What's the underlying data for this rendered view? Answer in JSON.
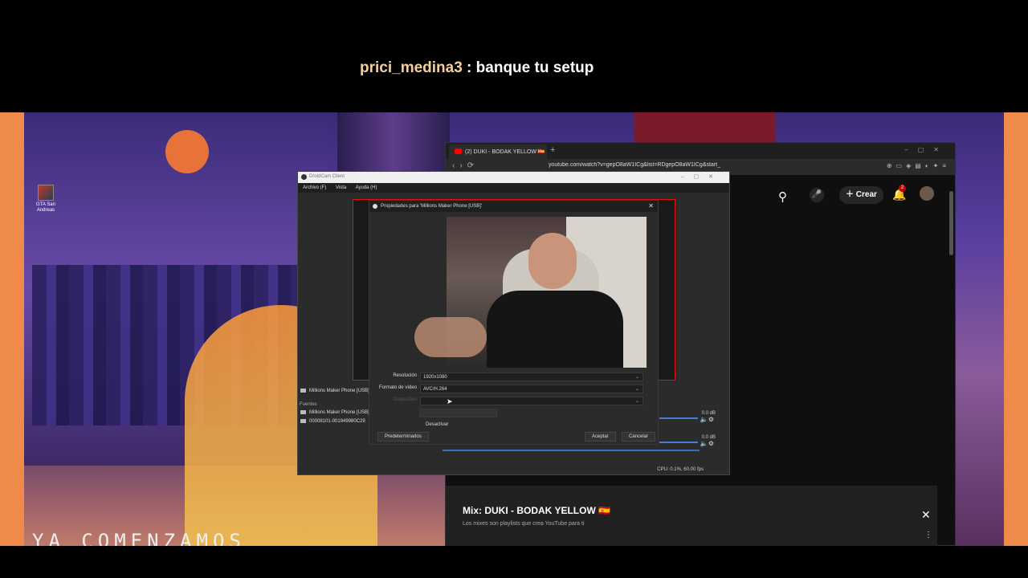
{
  "chat": {
    "username": "prici_medina3",
    "separator": " : ",
    "message": "banque tu setup"
  },
  "overlay": {
    "banner": "YA COMENZAMOS"
  },
  "desktop": {
    "icon_label": "GTA San Andreas"
  },
  "browser": {
    "tab_title": "(2) DUKI - BODAK YELLOW 🇪🇸",
    "url": "youtube.com/watch?v=gepO8aW1ICg&list=RDgepO8aW1ICg&start_",
    "create_label": "Crear",
    "notif_count": "2",
    "mix_title": "Mix: DUKI - BODAK YELLOW 🇪🇸",
    "mix_subtitle": "Los mixes son playlists que crea YouTube para ti"
  },
  "obs": {
    "title": "DroidCam Client",
    "menu": [
      "Archivo (F)",
      "Vista",
      "Ayuda (H)"
    ],
    "scene_source_label": "Millions Maker Phone [USB]",
    "sources_header": "Fuentes",
    "sources": [
      "Millions Maker Phone [USB]",
      "00008101-001949980C29"
    ],
    "mixer_db": [
      "0.0 dB",
      "0.0 dB"
    ],
    "status": "CPU: 0.1%, 60.00 fps"
  },
  "props": {
    "title": "Propiedades para 'Millions Maker Phone [USB]'",
    "fields": [
      {
        "label": "Resolución",
        "value": "1920x1080"
      },
      {
        "label": "Formato de vídeo",
        "value": "AVC/H.264"
      },
      {
        "label": "Dispositivo",
        "value": ""
      }
    ],
    "deactivate": "Desactivar",
    "defaults": "Predeterminados",
    "accept": "Aceptar",
    "cancel": "Cancelar"
  },
  "colors": {
    "accent_red": "#e01010",
    "yt_red": "#ff0000",
    "chat_user": "#f3cf9c",
    "side_orange": "#f08a4a"
  }
}
